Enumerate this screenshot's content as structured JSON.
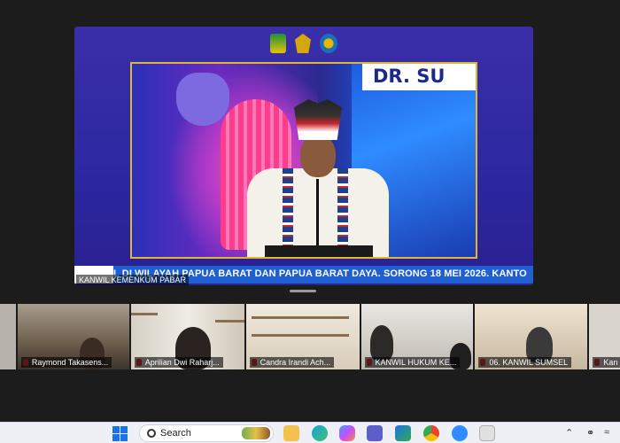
{
  "stage": {
    "video_banner_text": "DR. SU",
    "ticker_text": "L DI WILAYAH PAPUA BARAT DAN PAPUA BARAT DAYA. SORONG 18 MEI 2026. KANTO",
    "source_label": "KANWIL KEMENKUM PABAR",
    "logo_icons": [
      "emblem-icon",
      "scales-icon",
      "seal-icon"
    ]
  },
  "participants": [
    {
      "name": ""
    },
    {
      "name": "Raymond Takasens..."
    },
    {
      "name": "Aprilian Dwi Raharj..."
    },
    {
      "name": "Candra Irandi Ach..."
    },
    {
      "name": "KANWIL HUKUM KE..."
    },
    {
      "name": "06. KANWIL SUMSEL"
    },
    {
      "name": "Kan"
    }
  ],
  "taskbar": {
    "search_label": "Search",
    "icons": [
      "windows-start-icon",
      "file-explorer-icon",
      "edge-browser-icon",
      "copilot-icon",
      "teams-icon",
      "store-icon",
      "chrome-icon",
      "zoom-icon",
      "snipping-tool-icon"
    ],
    "tray_icons": [
      "chevron-up-icon",
      "network-icon",
      "wifi-icon"
    ]
  },
  "colors": {
    "stage_bg": "#2c27a0",
    "video_border": "#e2b536",
    "ticker_bg": "#1f5fd0",
    "mute_red": "#e0393e",
    "taskbar_bg": "#eef0f6"
  }
}
